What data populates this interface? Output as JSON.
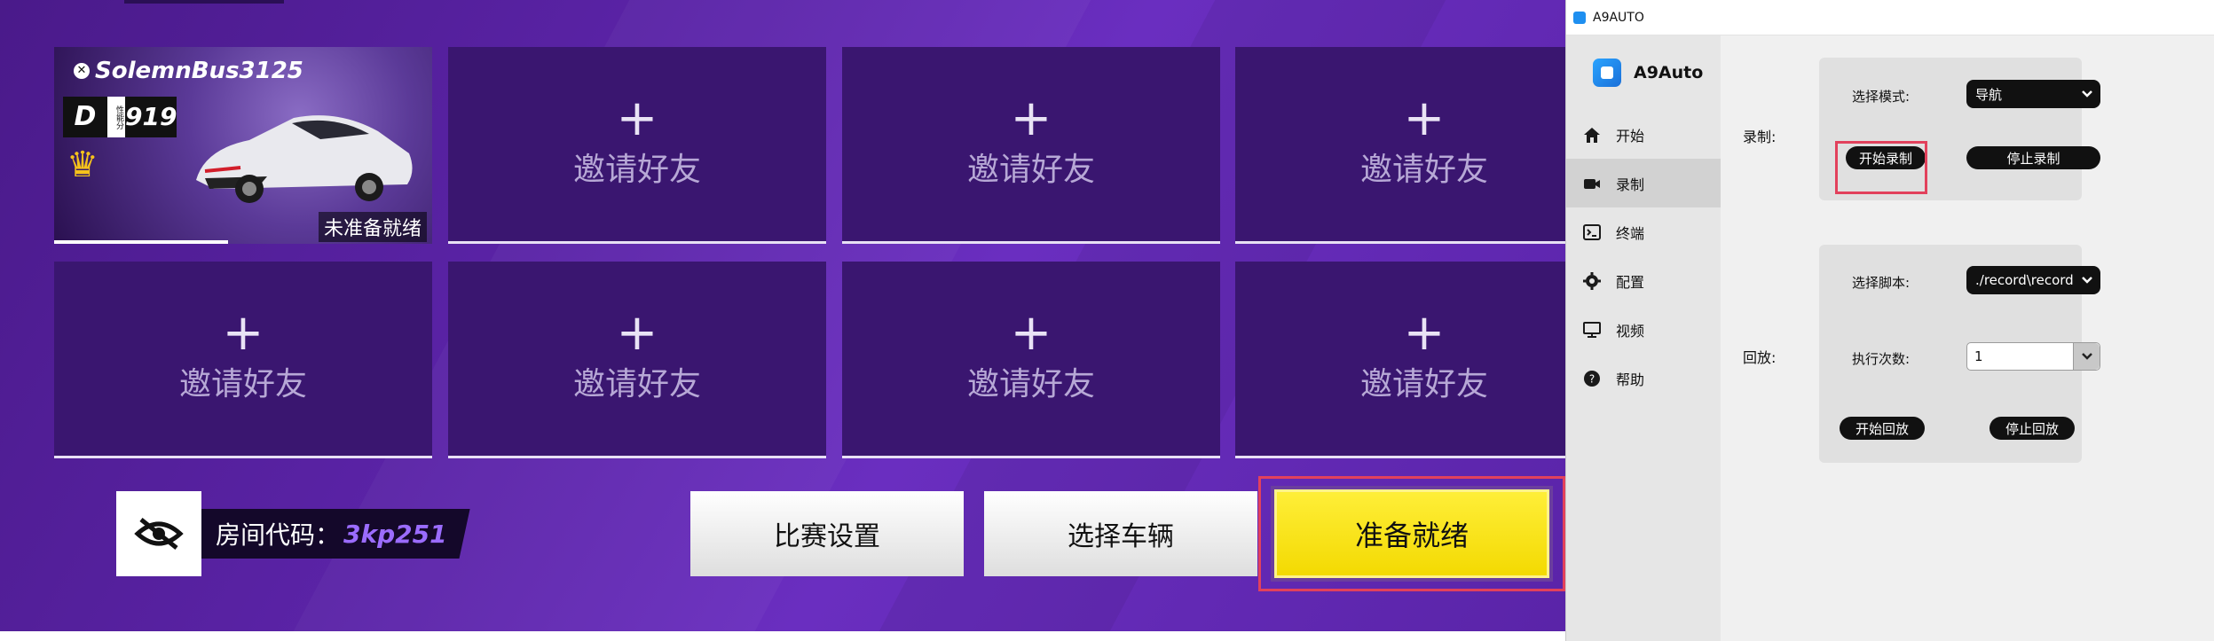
{
  "game": {
    "player": {
      "gamertag": "SolemnBus3125",
      "class": "D",
      "rating_label": "性能分",
      "rating": "919",
      "status": "未准备就绪",
      "progress": 0.46
    },
    "invite_plus": "+",
    "invite_label": "邀请好友",
    "room_code_label": "房间代码：",
    "room_code_value": "3kp251",
    "race_settings": "比赛设置",
    "select_vehicle": "选择车辆",
    "ready": "准备就绪",
    "colors": {
      "ready_yellow": "#f6e000",
      "highlight_red": "#e2415c",
      "room_code_accent": "#9b6cff"
    }
  },
  "window": {
    "title": "A9AUTO",
    "brand": "A9Auto",
    "nav": [
      {
        "label": "开始",
        "icon": "home-icon"
      },
      {
        "label": "录制",
        "icon": "video-camera-icon",
        "active": true
      },
      {
        "label": "终端",
        "icon": "terminal-icon"
      },
      {
        "label": "配置",
        "icon": "gear-icon"
      },
      {
        "label": "视频",
        "icon": "monitor-icon"
      },
      {
        "label": "帮助",
        "icon": "help-icon"
      }
    ],
    "record": {
      "section_label": "录制:",
      "mode_label": "选择模式:",
      "mode_value": "导航",
      "start": "开始录制",
      "stop": "停止录制"
    },
    "playback": {
      "section_label": "回放:",
      "script_label": "选择脚本:",
      "script_value": "./record\\record",
      "runs_label": "执行次数:",
      "runs_value": "1",
      "start": "开始回放",
      "stop": "停止回放"
    }
  }
}
